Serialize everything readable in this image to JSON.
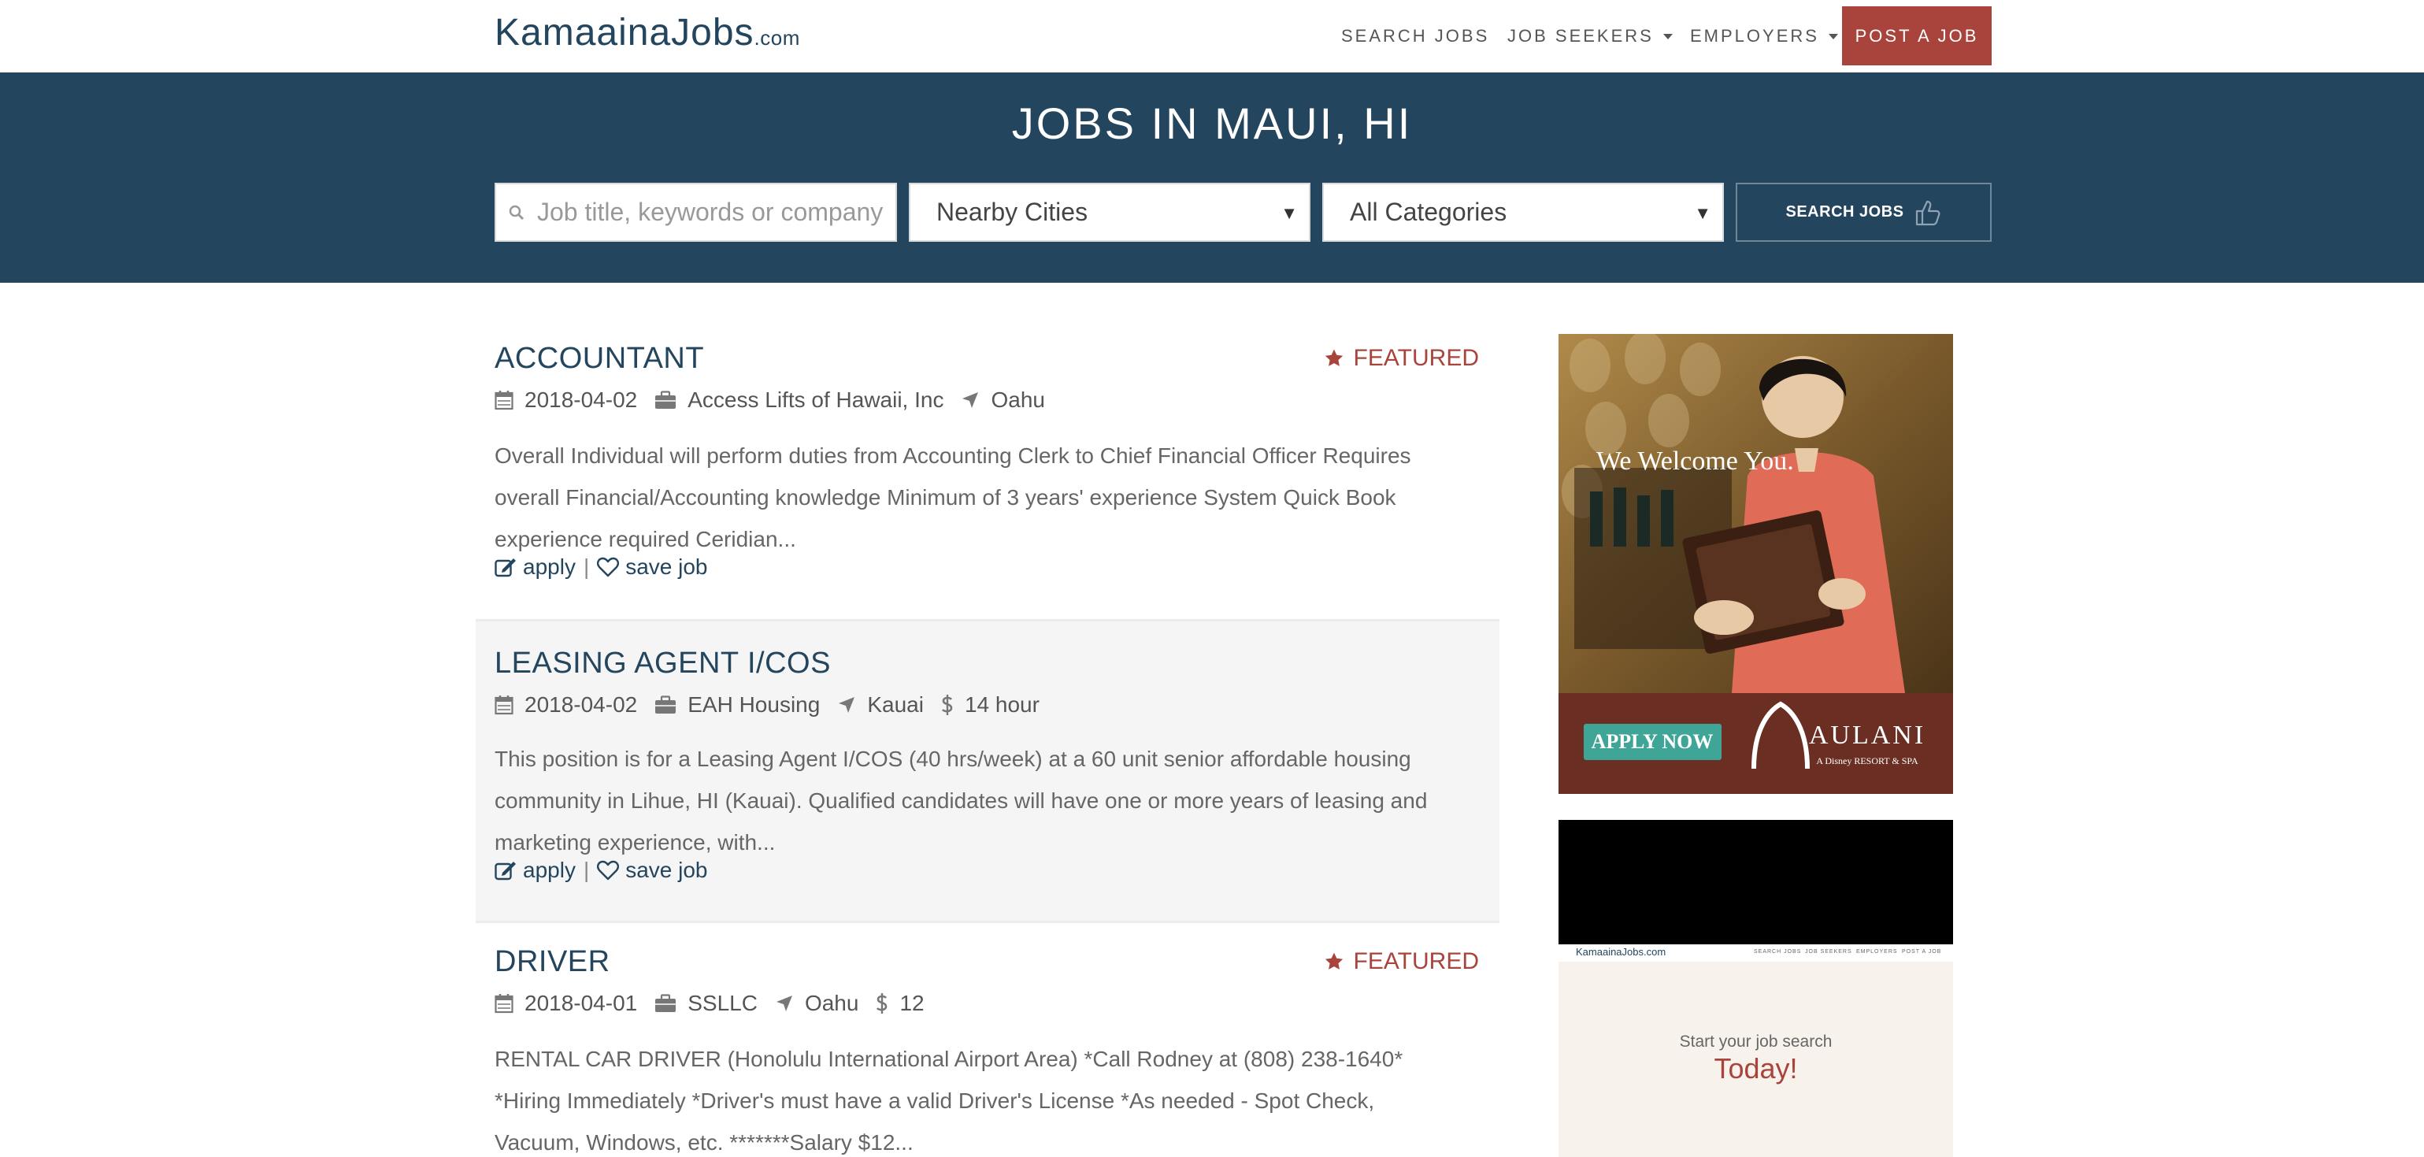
{
  "brand": {
    "name": "KamaainaJobs",
    "suffix": ".com"
  },
  "nav": {
    "search_jobs": "SEARCH JOBS",
    "job_seekers": "JOB SEEKERS",
    "employers": "EMPLOYERS",
    "post_job": "POST A JOB"
  },
  "hero": {
    "title": "JOBS IN MAUI, HI",
    "search_placeholder": "Job title, keywords or company",
    "city_select": "Nearby Cities",
    "category_select": "All Categories",
    "search_button": "SEARCH JOBS"
  },
  "jobs": [
    {
      "title": "ACCOUNTANT",
      "featured": "FEATURED",
      "date": "2018-04-02",
      "company": "Access Lifts of Hawaii, Inc",
      "location": "Oahu",
      "pay": "",
      "description": "Overall  Individual will perform duties from Accounting Clerk to Chief Financial Officer Requires overall Financial/Accounting knowledge Minimum of 3 years' experience System Quick Book experience required Ceridian...",
      "apply": "apply",
      "save": "save job"
    },
    {
      "title": "LEASING AGENT I/COS",
      "featured": "",
      "date": "2018-04-02",
      "company": "EAH Housing",
      "location": "Kauai",
      "pay": "14 hour",
      "description": "This position is for a Leasing Agent I/COS (40 hrs/week) at a 60 unit senior affordable housing community in Lihue, HI (Kauai). Qualified candidates will have one or more years of leasing and marketing experience, with...",
      "apply": "apply",
      "save": "save job"
    },
    {
      "title": "DRIVER",
      "featured": "FEATURED",
      "date": "2018-04-01",
      "company": "SSLLC",
      "location": "Oahu",
      "pay": "12",
      "description": "RENTAL CAR DRIVER (Honolulu International Airport Area) *Call Rodney at (808) 238-1640* *Hiring Immediately *Driver's must have a valid Driver's License *As needed - Spot Check, Vacuum, Windows, etc. *******Salary $12...",
      "apply": "apply",
      "save": "save job"
    }
  ],
  "ads": {
    "aulani": {
      "headline": "We Welcome You.",
      "cta": "APPLY NOW",
      "brand": "AULANI",
      "sub": "A Disney RESORT & SPA"
    },
    "kamaaina": {
      "mini_logo": "KamaainaJobs.com",
      "mini_nav": [
        "SEARCH JOBS",
        "JOB SEEKERS",
        "EMPLOYERS",
        "POST A JOB"
      ],
      "line1": "Start your job search",
      "line2": "Today!"
    }
  },
  "colors": {
    "primary": "#23455e",
    "accent": "#a8443b",
    "alt_row": "#f5f5f5"
  }
}
